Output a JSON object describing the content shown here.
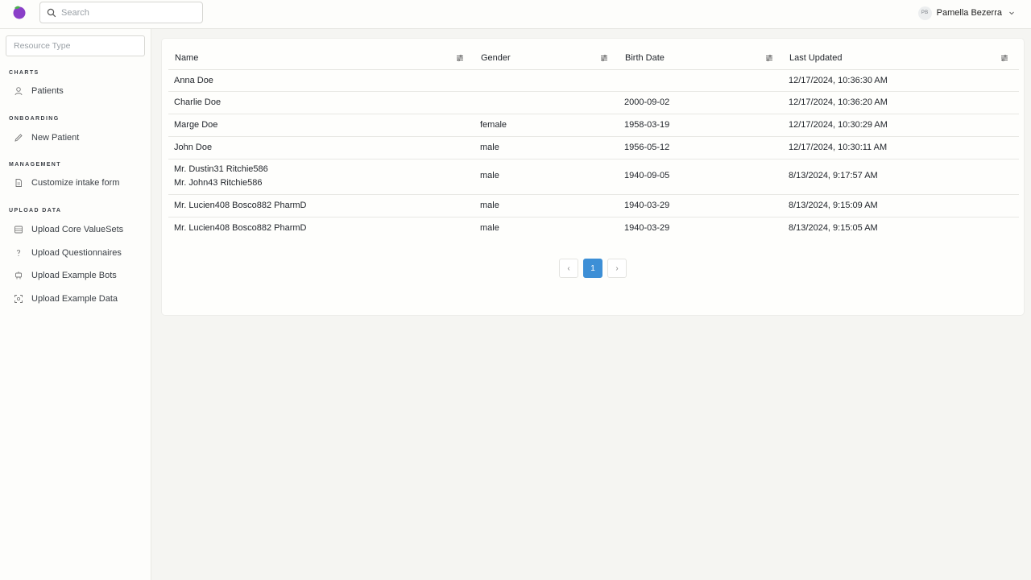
{
  "header": {
    "search_placeholder": "Search",
    "user": {
      "initials": "PB",
      "name": "Pamella Bezerra"
    }
  },
  "sidebar": {
    "resource_placeholder": "Resource Type",
    "sections": [
      {
        "title": "CHARTS",
        "items": [
          {
            "label": "Patients",
            "icon": "user-icon"
          }
        ]
      },
      {
        "title": "ONBOARDING",
        "items": [
          {
            "label": "New Patient",
            "icon": "pencil-icon"
          }
        ]
      },
      {
        "title": "MANAGEMENT",
        "items": [
          {
            "label": "Customize intake form",
            "icon": "file-icon"
          }
        ]
      },
      {
        "title": "UPLOAD DATA",
        "items": [
          {
            "label": "Upload Core ValueSets",
            "icon": "table-icon"
          },
          {
            "label": "Upload Questionnaires",
            "icon": "question-icon"
          },
          {
            "label": "Upload Example Bots",
            "icon": "robot-icon"
          },
          {
            "label": "Upload Example Data",
            "icon": "scan-icon"
          }
        ]
      }
    ]
  },
  "table": {
    "columns": [
      "Name",
      "Gender",
      "Birth Date",
      "Last Updated"
    ],
    "rows": [
      {
        "name": "Anna Doe",
        "name2": "",
        "gender": "",
        "birth_date": "",
        "last_updated": "12/17/2024, 10:36:30 AM"
      },
      {
        "name": "Charlie Doe",
        "name2": "",
        "gender": "",
        "birth_date": "2000-09-02",
        "last_updated": "12/17/2024, 10:36:20 AM"
      },
      {
        "name": "Marge Doe",
        "name2": "",
        "gender": "female",
        "birth_date": "1958-03-19",
        "last_updated": "12/17/2024, 10:30:29 AM"
      },
      {
        "name": "John Doe",
        "name2": "",
        "gender": "male",
        "birth_date": "1956-05-12",
        "last_updated": "12/17/2024, 10:30:11 AM"
      },
      {
        "name": "Mr. Dustin31 Ritchie586",
        "name2": "Mr. John43 Ritchie586",
        "gender": "male",
        "birth_date": "1940-09-05",
        "last_updated": "8/13/2024, 9:17:57 AM"
      },
      {
        "name": "Mr. Lucien408 Bosco882 PharmD",
        "name2": "",
        "gender": "male",
        "birth_date": "1940-03-29",
        "last_updated": "8/13/2024, 9:15:09 AM"
      },
      {
        "name": "Mr. Lucien408 Bosco882 PharmD",
        "name2": "",
        "gender": "male",
        "birth_date": "1940-03-29",
        "last_updated": "8/13/2024, 9:15:05 AM"
      }
    ]
  },
  "pagination": {
    "prev": "‹",
    "current_page": "1",
    "next": "›"
  },
  "colors": {
    "accent": "#3d8fd6",
    "logo_purple": "#8a3fc8",
    "logo_green": "#4caf50"
  }
}
